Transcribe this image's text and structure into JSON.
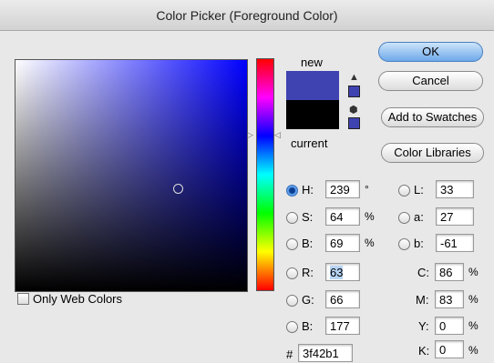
{
  "window": {
    "title": "Color Picker (Foreground Color)"
  },
  "preview": {
    "new_label": "new",
    "current_label": "current",
    "new_color": "#3f42b1",
    "current_color": "#000000"
  },
  "buttons": {
    "ok": "OK",
    "cancel": "Cancel",
    "add": "Add to Swatches",
    "libraries": "Color Libraries"
  },
  "only_web": "Only Web Colors",
  "hsb": {
    "h_label": "H:",
    "h": "239",
    "h_unit": "°",
    "s_label": "S:",
    "s": "64",
    "s_unit": "%",
    "b_label": "B:",
    "b": "69",
    "b_unit": "%"
  },
  "rgb": {
    "r_label": "R:",
    "r": "63",
    "g_label": "G:",
    "g": "66",
    "b_label": "B:",
    "b": "177"
  },
  "lab": {
    "l_label": "L:",
    "l": "33",
    "a_label": "a:",
    "a": "27",
    "b_label": "b:",
    "b": "-61"
  },
  "cmyk": {
    "c_label": "C:",
    "c": "86",
    "m_label": "M:",
    "m": "83",
    "y_label": "Y:",
    "y": "0",
    "k_label": "K:",
    "k": "0",
    "unit": "%"
  },
  "hex": {
    "label": "#",
    "value": "3f42b1"
  },
  "icons": {
    "warning": "warning-triangle-icon",
    "cube": "web-safe-cube-icon"
  }
}
